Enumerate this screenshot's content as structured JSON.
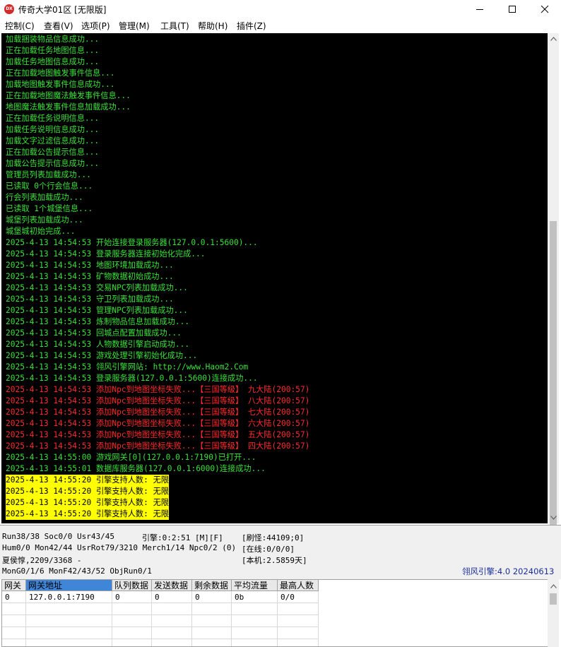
{
  "window": {
    "icon_text": "DX",
    "title": "传奇大学01区 [无限版]"
  },
  "menu": [
    "控制(C)",
    "查看(V)",
    "选项(P)",
    "管理(M)",
    "工具(T)",
    "帮助(H)",
    "插件(Z)"
  ],
  "console": {
    "lines": [
      {
        "text": "加载捆装物品信息成功...",
        "style": "green"
      },
      {
        "text": "正在加载任务地图信息...",
        "style": "green"
      },
      {
        "text": "加载任务地图信息成功...",
        "style": "green"
      },
      {
        "text": "正在加载地图触发事件信息...",
        "style": "green"
      },
      {
        "text": "加载地图触发事件信息成功...",
        "style": "green"
      },
      {
        "text": "正在加载地图魔法触发事件信息...",
        "style": "green"
      },
      {
        "text": "地图魔法触发事件信息加载成功...",
        "style": "green"
      },
      {
        "text": "正在加载任务说明信息...",
        "style": "green"
      },
      {
        "text": "加载任务说明信息成功...",
        "style": "green"
      },
      {
        "text": "加载文字过滤信息成功...",
        "style": "green"
      },
      {
        "text": "正在加载公告提示信息...",
        "style": "green"
      },
      {
        "text": "加载公告提示信息成功...",
        "style": "green"
      },
      {
        "text": "管理员列表加载成功...",
        "style": "green"
      },
      {
        "text": "已读取 0个行会信息...",
        "style": "green"
      },
      {
        "text": "行会列表加载成功...",
        "style": "green"
      },
      {
        "text": "已读取 1个城堡信息...",
        "style": "green"
      },
      {
        "text": "城堡列表加载成功...",
        "style": "green"
      },
      {
        "text": "城堡城初始完成...",
        "style": "green"
      },
      {
        "text": "2025-4-13 14:54:53 开始连接登录服务器(127.0.0.1:5600)...",
        "style": "green"
      },
      {
        "text": "2025-4-13 14:54:53 登录服务器连接初始化完成...",
        "style": "green"
      },
      {
        "text": "2025-4-13 14:54:53 地图环境加载成功...",
        "style": "green"
      },
      {
        "text": "2025-4-13 14:54:53 矿物数据初始成功...",
        "style": "green"
      },
      {
        "text": "2025-4-13 14:54:53 交易NPC列表加载成功...",
        "style": "green"
      },
      {
        "text": "2025-4-13 14:54:53 守卫列表加载成功...",
        "style": "green"
      },
      {
        "text": "2025-4-13 14:54:53 管理NPC列表加载成功...",
        "style": "green"
      },
      {
        "text": "2025-4-13 14:54:53 炼制物品信息加载成功...",
        "style": "green"
      },
      {
        "text": "2025-4-13 14:54:53 回城点配置加载成功...",
        "style": "green"
      },
      {
        "text": "2025-4-13 14:54:53 人物数据引擎启动成功...",
        "style": "green"
      },
      {
        "text": "2025-4-13 14:54:53 游戏处理引擎初始化成功...",
        "style": "green"
      },
      {
        "text": "2025-4-13 14:54:53 翎风引擎网站: http://www.Haom2.Com",
        "style": "green"
      },
      {
        "text": "2025-4-13 14:54:53 登录服务器(127.0.0.1:5600)连接成功...",
        "style": "green"
      },
      {
        "text": "2025-4-13 14:54:53 添加Npc到地图坐标失败...【三国等级】 九大陆(200:57)",
        "style": "red"
      },
      {
        "text": "2025-4-13 14:54:53 添加Npc到地图坐标失败...【三国等级】 八大陆(200:57)",
        "style": "red"
      },
      {
        "text": "2025-4-13 14:54:53 添加Npc到地图坐标失败...【三国等级】 七大陆(200:57)",
        "style": "red"
      },
      {
        "text": "2025-4-13 14:54:53 添加Npc到地图坐标失败...【三国等级】 六大陆(200:57)",
        "style": "red"
      },
      {
        "text": "2025-4-13 14:54:53 添加Npc到地图坐标失败...【三国等级】 五大陆(200:57)",
        "style": "red"
      },
      {
        "text": "2025-4-13 14:54:53 添加Npc到地图坐标失败...【三国等级】 四大陆(200:57)",
        "style": "red"
      },
      {
        "text": "2025-4-13 14:55:00 游戏网关[0](127.0.0.1:7190)已打开...",
        "style": "green"
      },
      {
        "text": "2025-4-13 14:55:01 数据库服务器(127.0.0.1:6000)连接成功...",
        "style": "green"
      },
      {
        "text": "2025-4-13 14:55:20 引擎支持人数: 无限",
        "style": "hl"
      },
      {
        "text": "2025-4-13 14:55:20 引擎支持人数: 无限",
        "style": "hl"
      },
      {
        "text": "2025-4-13 14:55:20 引擎支持人数: 无限",
        "style": "hl"
      },
      {
        "text": "2025-4-13 14:55:20 引擎支持人数: 无限",
        "style": "hl"
      }
    ]
  },
  "status": {
    "run": "Run38/38 Soc0/0 Usr43/45",
    "engine": "引擎:0:2:51 [M][F]",
    "refresh": "[刷怪:44109;0]",
    "hum": "Hum0/0 Mon42/44 UsrRot79/3210 Merch1/14 Npc0/2 (0)",
    "online": "[在线:0/0/0]",
    "user": "夏侯惇,2209/3368 -",
    "local": "[本机:2.5859天]",
    "mong": "MonG0/1/6 MonF42/43/52 ObjRun0/1",
    "version": "翎风引擎:4.0 20240613"
  },
  "gate_table": {
    "headers": [
      "网关",
      "网关地址",
      "队列数据",
      "发送数据",
      "剩余数据",
      "平均流量",
      "最高人数"
    ],
    "rows": [
      [
        "0",
        "127.0.0.1:7190",
        "0",
        "0",
        "0",
        "0b",
        "0/0"
      ]
    ]
  }
}
